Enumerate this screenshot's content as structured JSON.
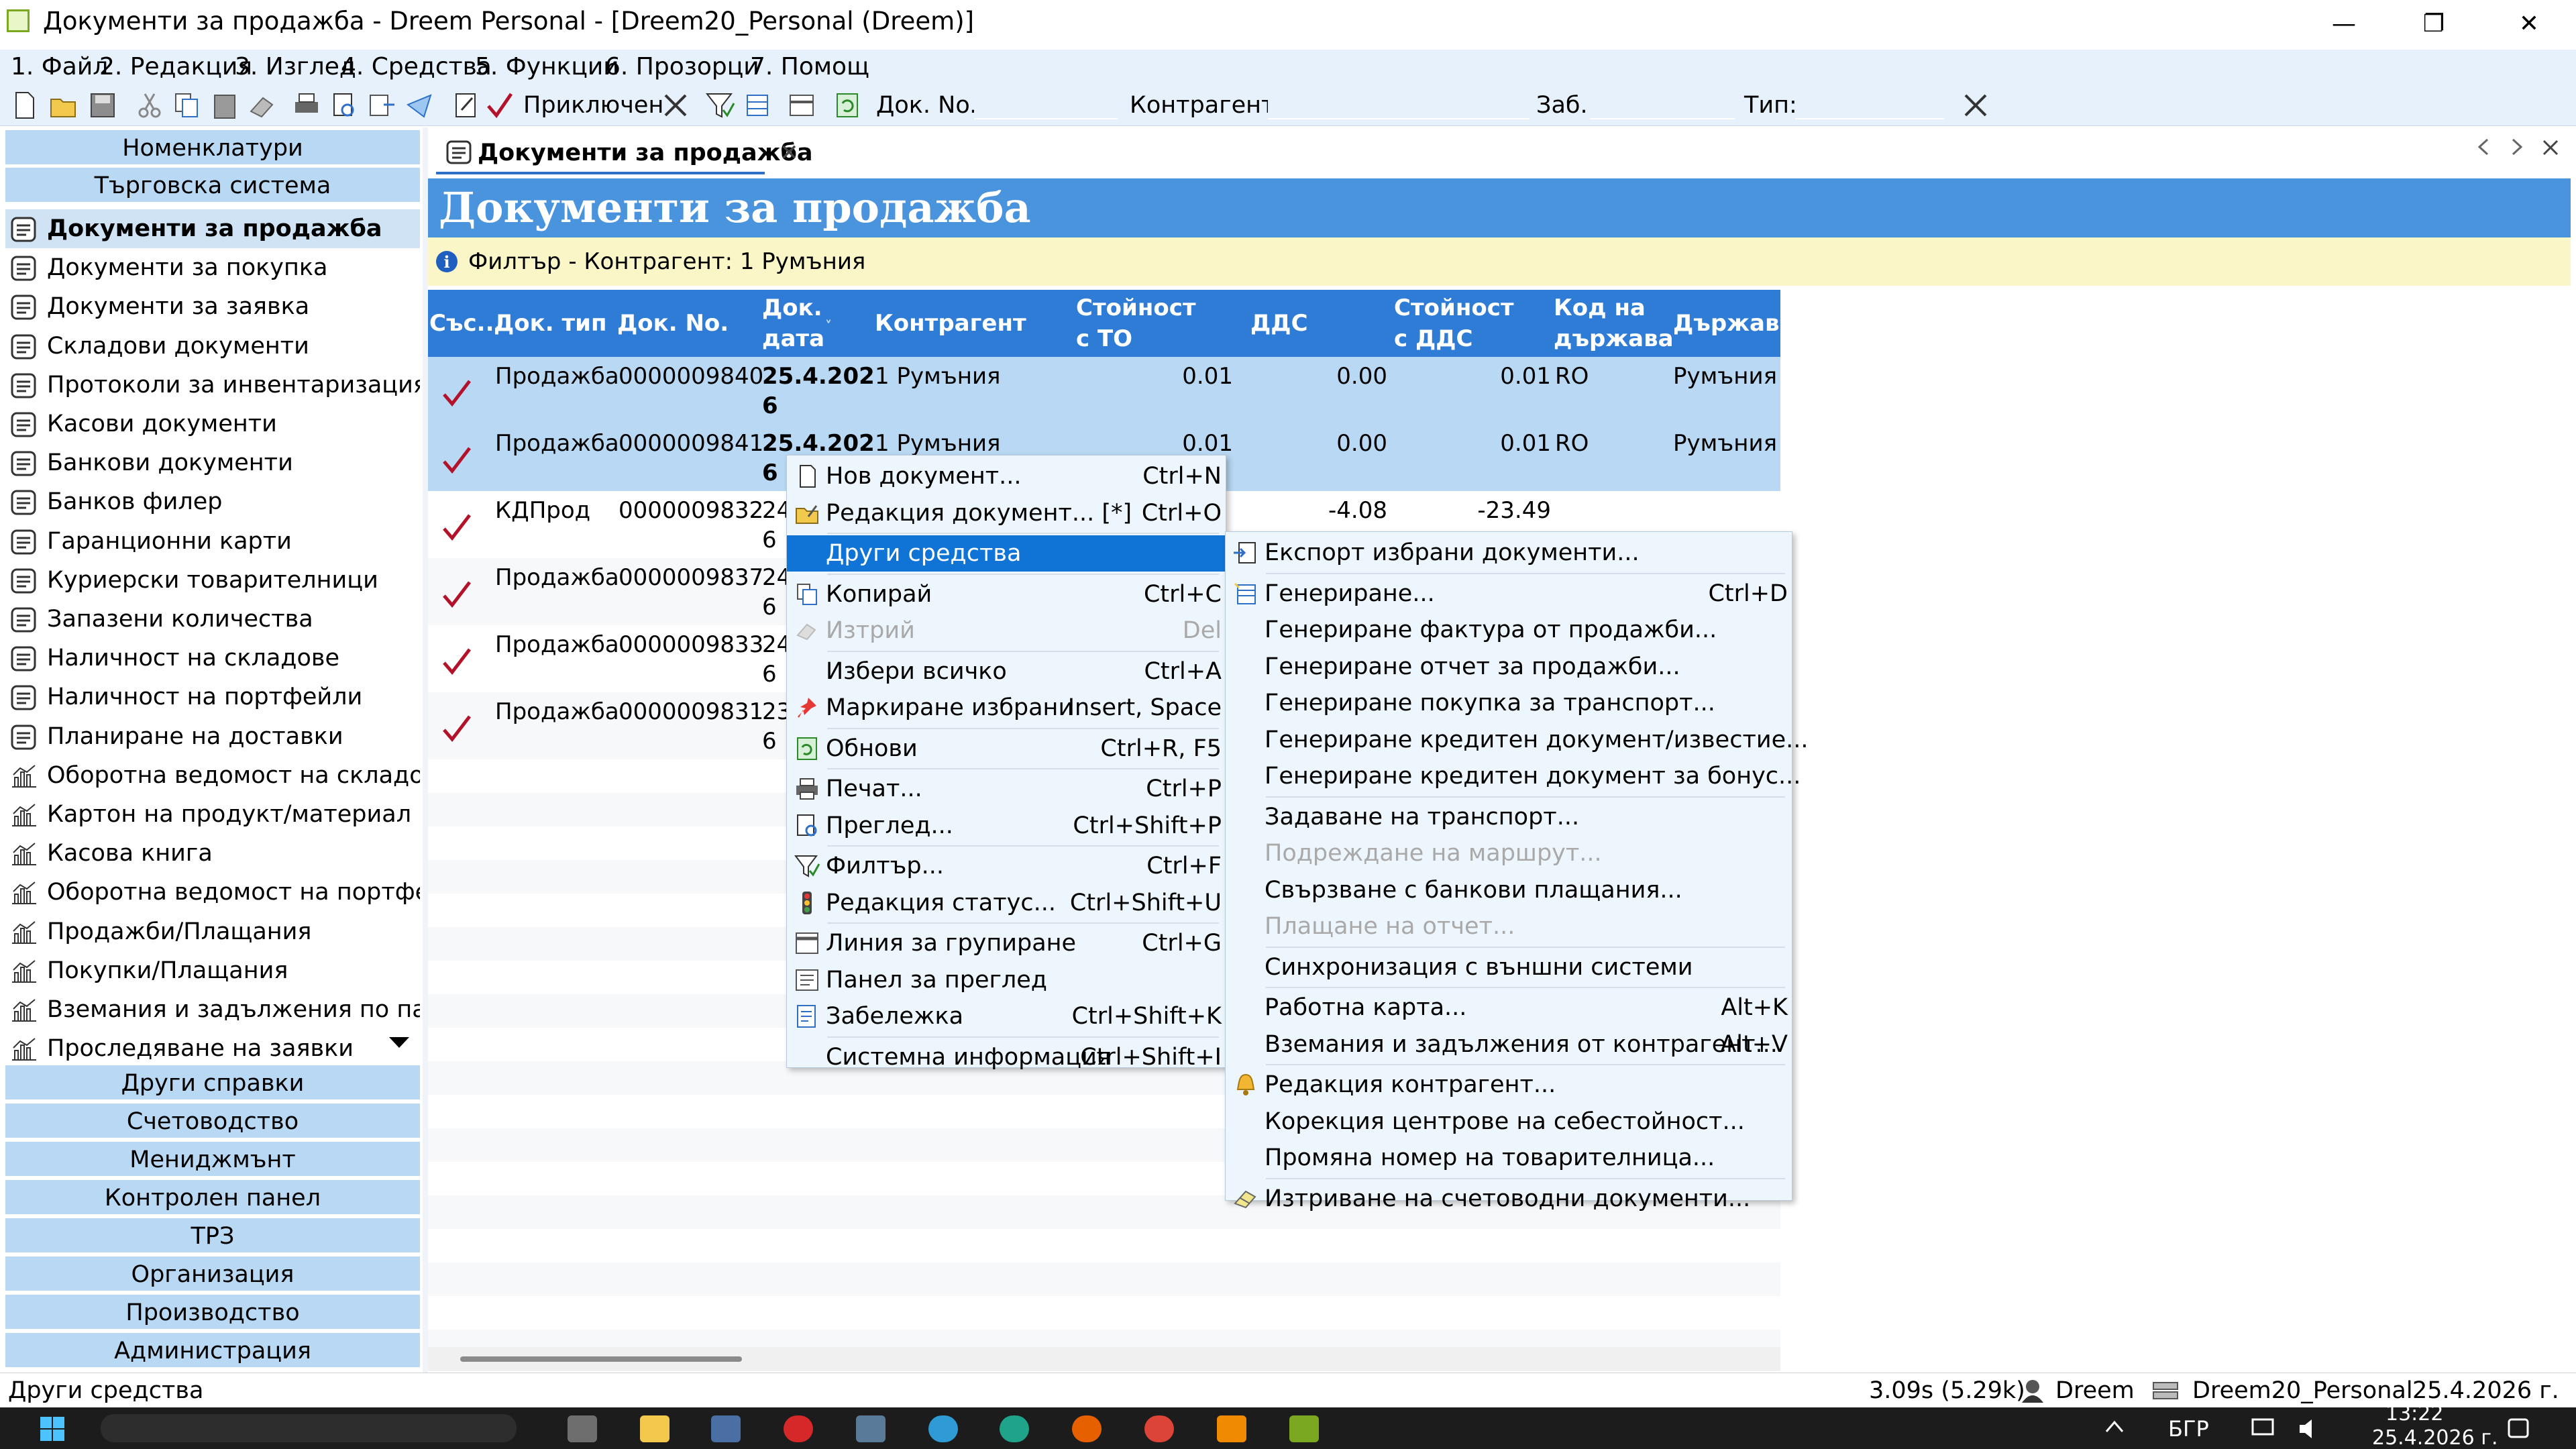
{
  "window": {
    "title": "Документи за продажба - Dreem Personal - [Dreem20_Personal (Dreem)]",
    "minimize": "—",
    "maximize": "❐",
    "close": "✕"
  },
  "menubar": [
    {
      "label": "1. Файл"
    },
    {
      "label": "2. Редакция"
    },
    {
      "label": "3. Изглед"
    },
    {
      "label": "4. Средства"
    },
    {
      "label": "5. Функции"
    },
    {
      "label": "6. Прозорци"
    },
    {
      "label": "7. Помощ"
    }
  ],
  "toolbar": {
    "status_filter": "Приключен",
    "doc_no_label": "Док. No.",
    "partner_label": "Контрагент:",
    "note_label": "Заб.",
    "type_label": "Тип:"
  },
  "sidebar": {
    "top_groups": [
      "Номенклатури",
      "Търговска система"
    ],
    "items": [
      {
        "label": "Документи за продажба",
        "icon": "document-icon"
      },
      {
        "label": "Документи за покупка",
        "icon": "document-icon"
      },
      {
        "label": "Документи за заявка",
        "icon": "document-icon"
      },
      {
        "label": "Складови документи",
        "icon": "document-icon"
      },
      {
        "label": "Протоколи за инвентаризация",
        "icon": "document-icon"
      },
      {
        "label": "Касови документи",
        "icon": "document-icon"
      },
      {
        "label": "Банкови документи",
        "icon": "document-icon"
      },
      {
        "label": "Банков филер",
        "icon": "document-icon"
      },
      {
        "label": "Гаранционни карти",
        "icon": "document-icon"
      },
      {
        "label": "Куриерски товарителници",
        "icon": "document-icon"
      },
      {
        "label": "Запазени количества",
        "icon": "document-icon"
      },
      {
        "label": "Наличност на складове",
        "icon": "document-icon"
      },
      {
        "label": "Наличност на портфейли",
        "icon": "document-icon"
      },
      {
        "label": "Планиране на доставки",
        "icon": "document-icon"
      },
      {
        "label": "Оборотна ведомост на складове",
        "icon": "report-icon"
      },
      {
        "label": "Картон на продукт/материал",
        "icon": "report-icon"
      },
      {
        "label": "Касова книга",
        "icon": "report-icon"
      },
      {
        "label": "Оборотна ведомост на портфе...",
        "icon": "report-icon"
      },
      {
        "label": "Продажби/Плащания",
        "icon": "report-icon"
      },
      {
        "label": "Покупки/Плащания",
        "icon": "report-icon"
      },
      {
        "label": "Вземания и задължения по пад...",
        "icon": "report-icon"
      },
      {
        "label": "Проследяване на заявки",
        "icon": "report-icon"
      }
    ],
    "bottom_groups": [
      "Други справки",
      "Счетоводство",
      "Мениджмънт",
      "Контролен панел",
      "ТРЗ",
      "Организация",
      "Производство",
      "Администрация"
    ]
  },
  "tab": {
    "label": "Документи за продажба"
  },
  "banner": {
    "title": "Документи за продажба"
  },
  "filter": {
    "text": "Филтър - Контрагент: 1 Румъния"
  },
  "grid": {
    "headers": [
      "Със...",
      "Док. тип",
      "Док. No.",
      "Док. дата",
      "Контрагент",
      "Стойност с ТО",
      "ДДС",
      "Стойност с ДДС",
      "Код на държава",
      "Държава"
    ],
    "rows": [
      {
        "type": "Продажба",
        "no": "0000009840",
        "date1": "25.4.202",
        "date2": "6",
        "partner": "1 Румъния",
        "val": "0.01",
        "vat": "0.00",
        "total": "0.01",
        "code": "RO",
        "country": "Румъния"
      },
      {
        "type": "Продажба",
        "no": "0000009841",
        "date1": "25.4.202",
        "date2": "6",
        "partner": "1 Румъния",
        "val": "0.01",
        "vat": "0.00",
        "total": "0.01",
        "code": "RO",
        "country": "Румъния"
      },
      {
        "type": "КДПрод",
        "no": "0000009832",
        "date1": "24",
        "date2": "6",
        "partner": "",
        "val": "",
        "vat": "-4.08",
        "total": "-23.49",
        "code": "",
        "country": ""
      },
      {
        "type": "Продажба",
        "no": "0000009837",
        "date1": "24",
        "date2": "6",
        "partner": "",
        "val": "",
        "vat": "",
        "total": "",
        "code": "",
        "country": ""
      },
      {
        "type": "Продажба",
        "no": "0000009833",
        "date1": "24",
        "date2": "6",
        "partner": "",
        "val": "",
        "vat": "",
        "total": "",
        "code": "",
        "country": ""
      },
      {
        "type": "Продажба",
        "no": "0000009831",
        "date1": "23",
        "date2": "6",
        "partner": "",
        "val": "",
        "vat": "",
        "total": "",
        "code": "",
        "country": ""
      }
    ]
  },
  "context_menu": [
    {
      "label": "Нов документ...",
      "shortcut": "Ctrl+N",
      "icon": "new-document-icon"
    },
    {
      "label": "Редакция документ... [*]",
      "shortcut": "Ctrl+O",
      "icon": "edit-document-icon"
    },
    {
      "label": "Други средства",
      "shortcut": "",
      "icon": ""
    },
    {
      "label": "Копирай",
      "shortcut": "Ctrl+C",
      "icon": "copy-icon"
    },
    {
      "label": "Изтрий",
      "shortcut": "Del",
      "icon": "delete-icon"
    },
    {
      "label": "Избери всичко",
      "shortcut": "Ctrl+A",
      "icon": ""
    },
    {
      "label": "Маркиране избрани",
      "shortcut": "Insert, Space",
      "icon": "pin-icon"
    },
    {
      "label": "Обнови",
      "shortcut": "Ctrl+R, F5",
      "icon": "refresh-icon"
    },
    {
      "label": "Печат...",
      "shortcut": "Ctrl+P",
      "icon": "print-icon"
    },
    {
      "label": "Преглед...",
      "shortcut": "Ctrl+Shift+P",
      "icon": "preview-icon"
    },
    {
      "label": "Филтър...",
      "shortcut": "Ctrl+F",
      "icon": "filter-icon"
    },
    {
      "label": "Редакция статус...",
      "shortcut": "Ctrl+Shift+U",
      "icon": "traffic-light-icon"
    },
    {
      "label": "Линия за групиране",
      "shortcut": "Ctrl+G",
      "icon": "grouping-icon"
    },
    {
      "label": "Панел за преглед",
      "shortcut": "",
      "icon": "panel-icon"
    },
    {
      "label": "Забележка",
      "shortcut": "Ctrl+Shift+K",
      "icon": "note-icon"
    },
    {
      "label": "Системна информация",
      "shortcut": "Ctrl+Shift+I",
      "icon": ""
    }
  ],
  "submenu": [
    {
      "label": "Експорт избрани документи...",
      "shortcut": "",
      "icon": "export-icon"
    },
    {
      "label": "Генериране...",
      "shortcut": "Ctrl+D",
      "icon": "generate-icon"
    },
    {
      "label": "Генериране фактура от продажби...",
      "shortcut": "",
      "icon": ""
    },
    {
      "label": "Генериране отчет за продажби...",
      "shortcut": "",
      "icon": ""
    },
    {
      "label": "Генериране покупка за транспорт...",
      "shortcut": "",
      "icon": ""
    },
    {
      "label": "Генериране кредитен документ/известие...",
      "shortcut": "",
      "icon": ""
    },
    {
      "label": "Генериране кредитен документ за бонус...",
      "shortcut": "",
      "icon": ""
    },
    {
      "label": "Задаване на транспорт...",
      "shortcut": "",
      "icon": ""
    },
    {
      "label": "Подреждане на маршрут...",
      "shortcut": "",
      "icon": ""
    },
    {
      "label": "Свързване с банкови плащания...",
      "shortcut": "",
      "icon": ""
    },
    {
      "label": "Плащане на отчет...",
      "shortcut": "",
      "icon": ""
    },
    {
      "label": "Синхронизация с външни системи",
      "shortcut": "",
      "icon": ""
    },
    {
      "label": "Работна карта...",
      "shortcut": "Alt+K",
      "icon": ""
    },
    {
      "label": "Вземания и задължения от контрагент...",
      "shortcut": "Alt+V",
      "icon": ""
    },
    {
      "label": "Редакция контрагент...",
      "shortcut": "",
      "icon": "bell-icon"
    },
    {
      "label": "Корекция центрове на себестойност...",
      "shortcut": "",
      "icon": ""
    },
    {
      "label": "Промяна номер на товарителница...",
      "shortcut": "",
      "icon": ""
    },
    {
      "label": "Изтриване на счетоводни документи...",
      "shortcut": "",
      "icon": "eraser-icon"
    }
  ],
  "statusbar": {
    "left": "Други средства",
    "timing": "3.09s (5.29k)",
    "user": "Dreem",
    "database": "Dreem20_Personal",
    "date": "25.4.2026 г."
  },
  "taskbar": {
    "lang": "БГР",
    "time": "13:22",
    "date": "25.4.2026 г."
  },
  "colors": {
    "accent": "#2f7cd6",
    "banner": "#4a93dd",
    "filter_bg": "#fbf6c7",
    "selection": "#b9d8f3",
    "menu_highlight": "#0f74d6",
    "check": "#b3122a"
  }
}
